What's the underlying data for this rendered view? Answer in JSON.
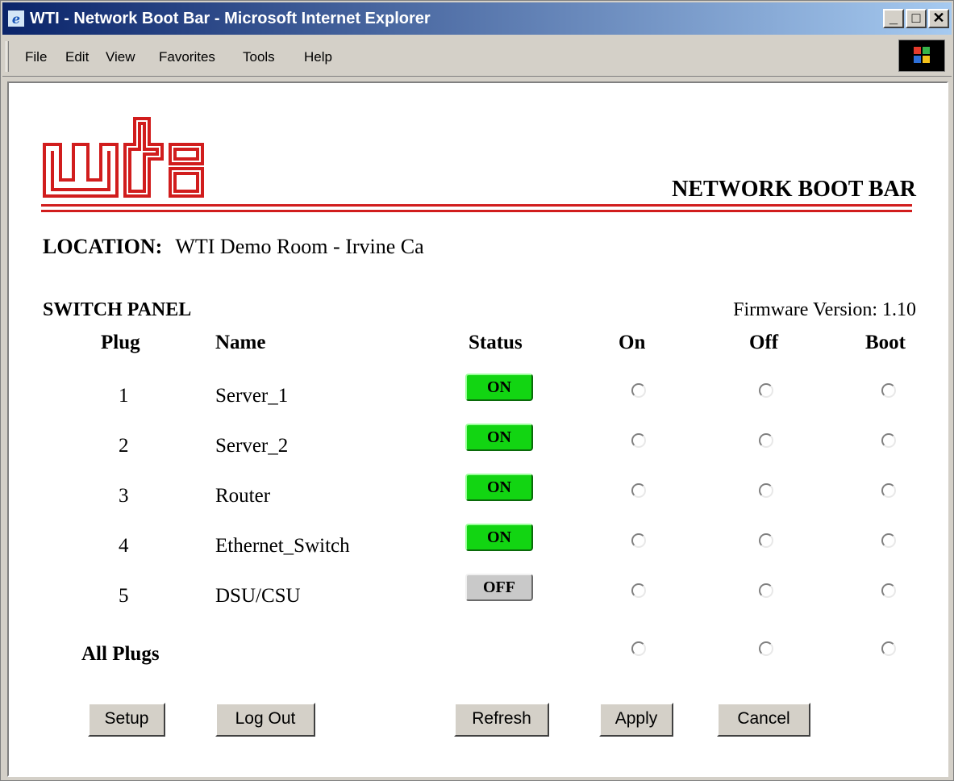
{
  "window": {
    "title": "WTI - Network Boot Bar - Microsoft Internet Explorer",
    "controls": {
      "minimize": "_",
      "maximize": "□",
      "close": "✕"
    }
  },
  "menu": [
    "File",
    "Edit",
    "View",
    "Favorites",
    "Tools",
    "Help"
  ],
  "header": {
    "logo_text": "wti",
    "title": "NETWORK BOOT BAR"
  },
  "location": {
    "label": "LOCATION:",
    "value": "WTI Demo Room - Irvine Ca"
  },
  "switch_panel": {
    "title": "SWITCH PANEL",
    "firmware": "Firmware Version: 1.10",
    "columns": [
      "Plug",
      "Name",
      "Status",
      "On",
      "Off",
      "Boot"
    ],
    "plugs": [
      {
        "plug": "1",
        "name": "Server_1",
        "status": "ON"
      },
      {
        "plug": "2",
        "name": "Server_2",
        "status": "ON"
      },
      {
        "plug": "3",
        "name": "Router",
        "status": "ON"
      },
      {
        "plug": "4",
        "name": "Ethernet_Switch",
        "status": "ON"
      },
      {
        "plug": "5",
        "name": "DSU/CSU",
        "status": "OFF"
      }
    ],
    "all_plugs_label": "All Plugs"
  },
  "buttons": {
    "setup": "Setup",
    "logout": "Log Out",
    "refresh": "Refresh",
    "apply": "Apply",
    "cancel": "Cancel"
  },
  "colors": {
    "brand_red": "#d11d1d",
    "status_on": "#12d512",
    "status_off": "#c9c9c9",
    "titlebar_start": "#0a246a"
  }
}
